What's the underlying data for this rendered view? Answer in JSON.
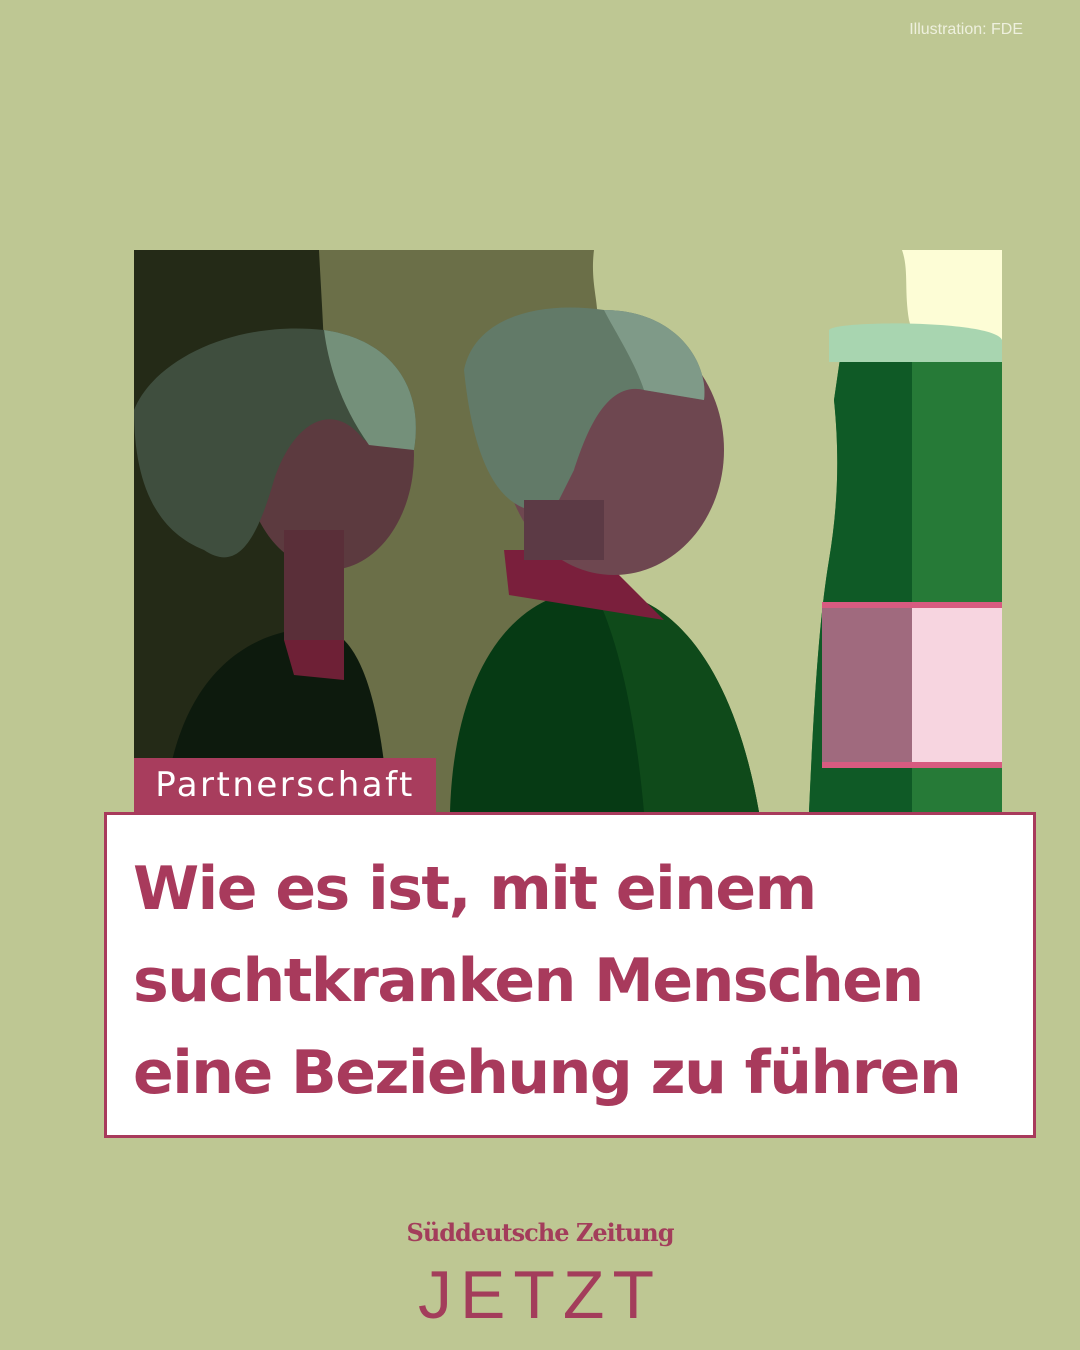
{
  "credit": "Illustration: FDE",
  "category_tag": "Partnerschaft",
  "headline_lines": [
    "Wie es ist, mit einem",
    "suchtkranken Menschen",
    "eine Beziehung zu führen"
  ],
  "brand": {
    "publisher": "Süddeutsche Zeitung",
    "name": "JETZT"
  },
  "colors": {
    "background": "#bec793",
    "accent": "#a83a5c",
    "bottle": "#267a37"
  }
}
